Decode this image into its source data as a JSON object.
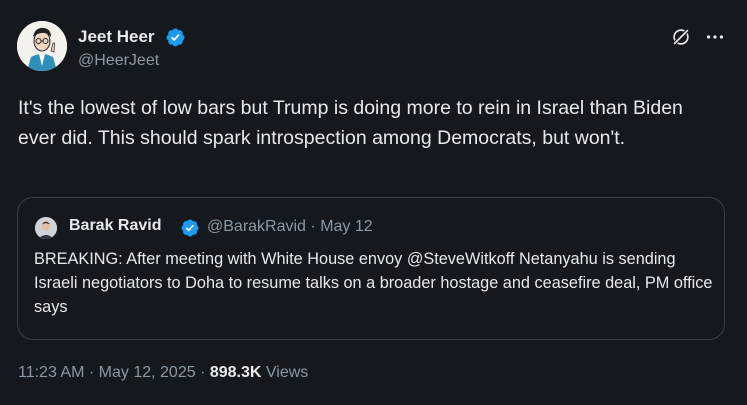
{
  "author": {
    "name": "Jeet Heer",
    "handle": "@HeerJeet"
  },
  "tweet": {
    "text": "It's the lowest of low bars but Trump is doing more to rein in Israel than Biden ever did. This should spark introspection among Democrats, but won't."
  },
  "quote": {
    "name": "Barak Ravid",
    "handle": "@BarakRavid",
    "separator": "·",
    "date": "May 12",
    "text": "BREAKING: After meeting with White House envoy @SteveWitkoff Netanyahu is sending Israeli negotiators to Doha to resume talks on a broader hostage and ceasefire deal, PM office says"
  },
  "footer": {
    "time": "11:23 AM",
    "separator": "·",
    "date": "May 12, 2025",
    "views_count": "898.3K",
    "views_label": "Views"
  },
  "icons": {
    "verified": "verified-badge-icon",
    "grok": "grok-icon",
    "more": "more-icon"
  },
  "colors": {
    "background": "#15181c",
    "text_primary": "#e7e9ea",
    "text_secondary": "#8b98a5",
    "verified_blue": "#1d9bf0",
    "border": "#3e4144"
  }
}
